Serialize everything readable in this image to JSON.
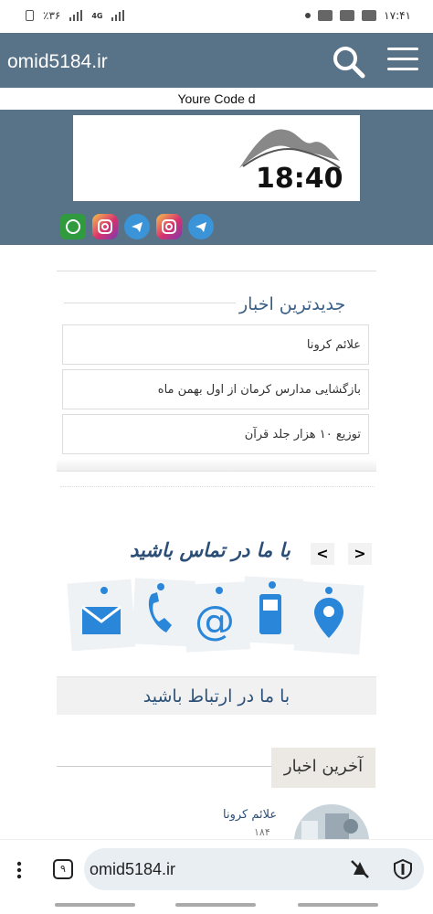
{
  "status_bar": {
    "battery": "٪۳۶",
    "network": "4G",
    "time": "۱۷:۴۱"
  },
  "topbar": {
    "site_title": "omid5184.ir"
  },
  "header": {
    "code_line": "Youre Code d"
  },
  "hero": {
    "clock_time": "18:40",
    "social_icons": [
      "whatsapp-icon",
      "instagram-icon",
      "telegram-icon",
      "instagram-icon",
      "telegram-icon"
    ]
  },
  "latest": {
    "title": "جدیدترین اخبار",
    "items": [
      "علائم کرونا",
      "بازگشایی مدارس کرمان از اول بهمن ماه",
      "توزیع ۱۰ هزار جلد قرآن"
    ]
  },
  "contact": {
    "banner_text": "با ما در تماس باشید",
    "prev_label": "<",
    "next_label": ">",
    "connect_text": "با ما در ارتباط باشید"
  },
  "last_news": {
    "tab_label": "آخرین اخبار",
    "item_title": "علائم کرونا",
    "item_sub": "۱۸۴"
  },
  "browser": {
    "url": "omid5184.ir",
    "tabs_count": "۹"
  },
  "colors": {
    "brand": "#587288",
    "title_blue": "#3a5f86"
  }
}
